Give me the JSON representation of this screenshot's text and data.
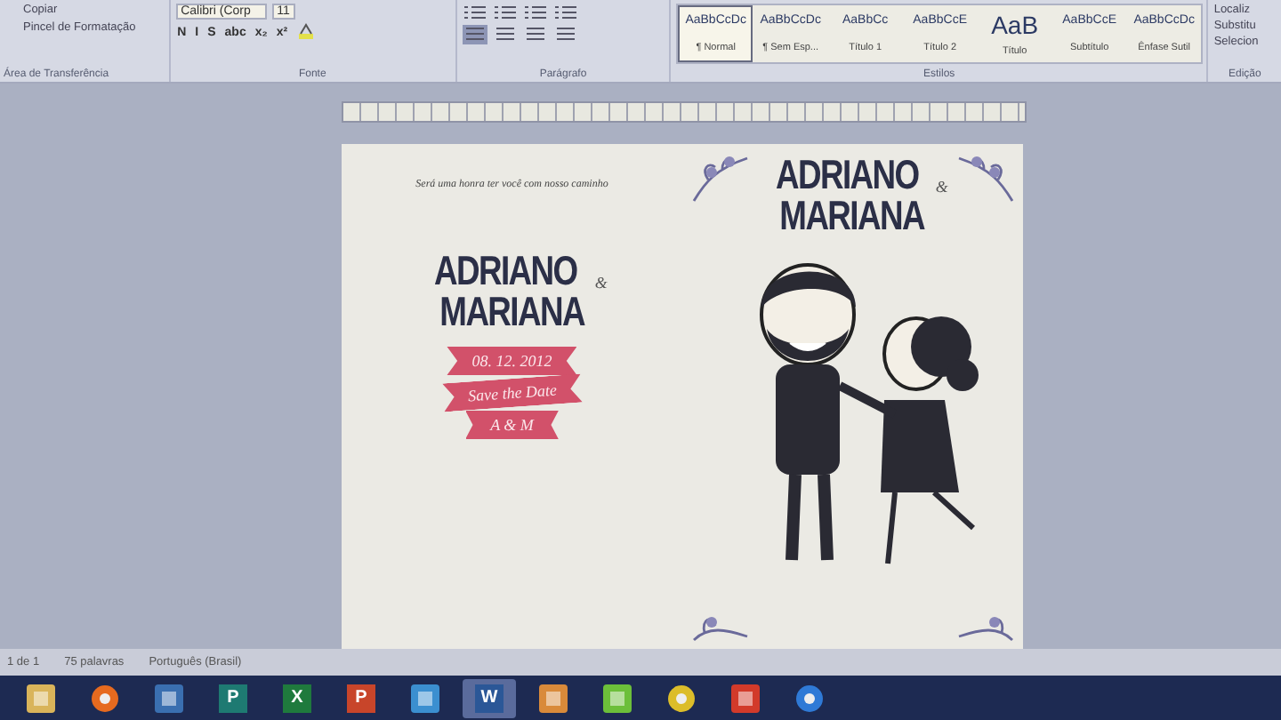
{
  "ribbon": {
    "clipboard": {
      "items": [
        "Copiar",
        "Pincel de Formatação"
      ],
      "label": "Área de Transferência"
    },
    "font": {
      "name": "Calibri (Corp",
      "size": "11",
      "format_buttons": [
        "N",
        "I",
        "S",
        "abc",
        "x₂",
        "x²"
      ],
      "label": "Fonte"
    },
    "paragraph": {
      "label": "Parágrafo"
    },
    "styles": {
      "items": [
        {
          "preview": "AaBbCcDc",
          "name": "¶ Normal",
          "selected": true
        },
        {
          "preview": "AaBbCcDc",
          "name": "¶ Sem Esp...",
          "selected": false
        },
        {
          "preview": "AaBbCc",
          "name": "Título 1",
          "selected": false
        },
        {
          "preview": "AaBbCcE",
          "name": "Título 2",
          "selected": false
        },
        {
          "preview": "AaB",
          "name": "Título",
          "selected": false
        },
        {
          "preview": "AaBbCcE",
          "name": "Subtítulo",
          "selected": false
        },
        {
          "preview": "AaBbCcDc",
          "name": "Ênfase Sutil",
          "selected": false
        }
      ],
      "label": "Estilos"
    },
    "editing": {
      "items": [
        "Localiz",
        "Substitu",
        "Selecion"
      ],
      "label": "Edição"
    }
  },
  "document": {
    "left": {
      "tagline": "Será uma honra ter você com nosso caminho",
      "name_1": "ADRIANO",
      "ampersand": "&",
      "name_2": "MARIANA",
      "banners": [
        "08. 12. 2012",
        "Save the Date",
        "A & M"
      ]
    },
    "right": {
      "name_1": "ADRIANO",
      "ampersand": "&",
      "name_2": "MARIANA"
    }
  },
  "status_bar": [
    "1 de 1",
    "75 palavras",
    "Português (Brasil)"
  ],
  "taskbar": {
    "apps": [
      {
        "kind": "folder",
        "selected": false
      },
      {
        "kind": "firefox",
        "selected": false
      },
      {
        "kind": "arrow",
        "selected": false
      },
      {
        "kind": "publisher",
        "label": "P",
        "selected": false
      },
      {
        "kind": "excel",
        "label": "X",
        "selected": false
      },
      {
        "kind": "powerpoint",
        "label": "P",
        "selected": false
      },
      {
        "kind": "media",
        "selected": false
      },
      {
        "kind": "word",
        "label": "W",
        "selected": true
      },
      {
        "kind": "paint",
        "selected": false
      },
      {
        "kind": "colors",
        "selected": false
      },
      {
        "kind": "chrome",
        "selected": false
      },
      {
        "kind": "red",
        "selected": false
      },
      {
        "kind": "blue",
        "selected": false
      }
    ]
  }
}
